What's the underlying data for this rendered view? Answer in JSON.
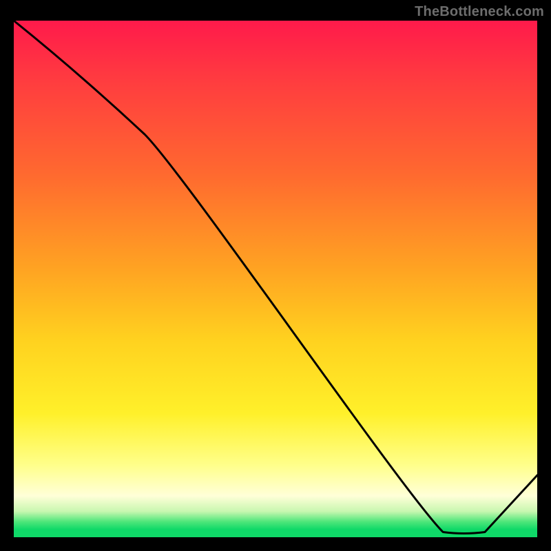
{
  "watermark": "TheBottleneck.com",
  "red_label": "",
  "chart_data": {
    "type": "line",
    "title": "",
    "xlabel": "",
    "ylabel": "",
    "xlim": [
      0,
      100
    ],
    "ylim": [
      0,
      100
    ],
    "series": [
      {
        "name": "curve",
        "x": [
          0,
          25,
          82,
          90,
          100
        ],
        "y": [
          100,
          78,
          1,
          1,
          12
        ]
      }
    ],
    "gradient_stops": [
      {
        "pos": 0,
        "color": "#ff1a4b"
      },
      {
        "pos": 12,
        "color": "#ff3d3f"
      },
      {
        "pos": 30,
        "color": "#ff6a2f"
      },
      {
        "pos": 48,
        "color": "#ffa322"
      },
      {
        "pos": 62,
        "color": "#ffd21f"
      },
      {
        "pos": 76,
        "color": "#fff02a"
      },
      {
        "pos": 86,
        "color": "#ffff8a"
      },
      {
        "pos": 92,
        "color": "#ffffd8"
      },
      {
        "pos": 95,
        "color": "#c8f7b0"
      },
      {
        "pos": 97,
        "color": "#4ee67a"
      },
      {
        "pos": 98.5,
        "color": "#0fd968"
      },
      {
        "pos": 100,
        "color": "#0fd968"
      }
    ],
    "red_label_x_frac": 0.8,
    "red_label_y_frac": 0.965
  }
}
